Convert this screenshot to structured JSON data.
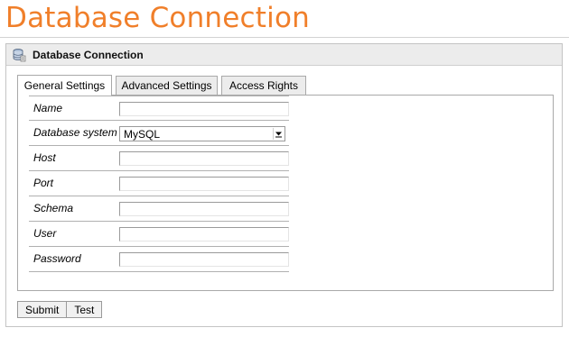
{
  "page": {
    "title": "Database Connection"
  },
  "panel": {
    "title": "Database Connection",
    "icon": "database-icon"
  },
  "tabs": [
    {
      "label": "General Settings",
      "active": true
    },
    {
      "label": "Advanced Settings",
      "active": false
    },
    {
      "label": "Access Rights",
      "active": false
    }
  ],
  "form": {
    "name": {
      "label": "Name",
      "value": ""
    },
    "database_system": {
      "label": "Database system",
      "value": "MySQL"
    },
    "host": {
      "label": "Host",
      "value": ""
    },
    "port": {
      "label": "Port",
      "value": ""
    },
    "schema": {
      "label": "Schema",
      "value": ""
    },
    "user": {
      "label": "User",
      "value": ""
    },
    "password": {
      "label": "Password",
      "value": ""
    }
  },
  "buttons": {
    "submit": "Submit",
    "test": "Test"
  },
  "colors": {
    "title": "#f07f2a",
    "header_bg": "#ececec",
    "border": "#a9a9a9"
  }
}
